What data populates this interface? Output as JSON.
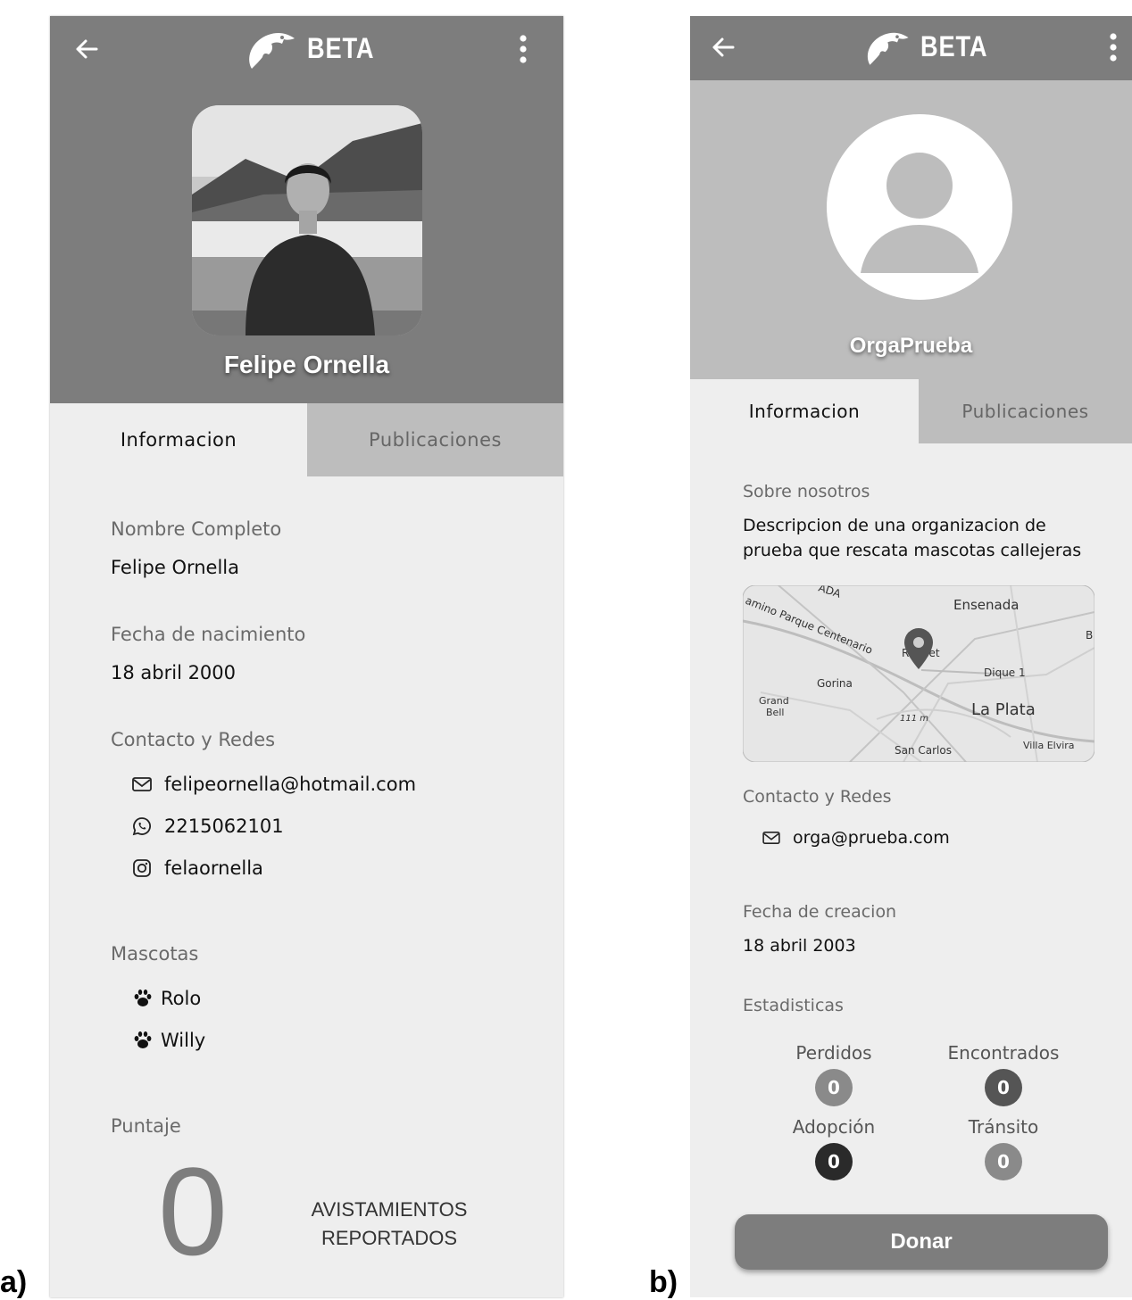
{
  "panel_labels": {
    "a": "a)",
    "b": "b)"
  },
  "app": {
    "logo_text": "BETA"
  },
  "screen_a": {
    "profile_name": "Felipe Ornella",
    "tabs": [
      {
        "label": "Informacion",
        "active": true
      },
      {
        "label": "Publicaciones",
        "active": false
      }
    ],
    "full_name": {
      "label": "Nombre Completo",
      "value": "Felipe Ornella"
    },
    "birth_date": {
      "label": "Fecha de nacimiento",
      "value": "18 abril 2000"
    },
    "contact": {
      "label": "Contacto y Redes",
      "items": [
        {
          "icon": "mail-icon",
          "value": "felipeornella@hotmail.com"
        },
        {
          "icon": "whatsapp-icon",
          "value": "2215062101"
        },
        {
          "icon": "instagram-icon",
          "value": "felaornella"
        }
      ]
    },
    "pets": {
      "label": "Mascotas",
      "items": [
        {
          "icon": "paw-icon",
          "name": "Rolo"
        },
        {
          "icon": "paw-icon",
          "name": "Willy"
        }
      ]
    },
    "score": {
      "label": "Puntaje",
      "value": "0",
      "caption_line1": "AVISTAMIENTOS",
      "caption_line2": "REPORTADOS"
    }
  },
  "screen_b": {
    "profile_name": "OrgaPrueba",
    "tabs": [
      {
        "label": "Informacion",
        "active": true
      },
      {
        "label": "Publicaciones",
        "active": false
      }
    ],
    "about": {
      "label": "Sobre nosotros",
      "line1": "Descripcion de una organizacion de",
      "line2": "prueba que rescata mascotas callejeras"
    },
    "map": {
      "labels": {
        "ensenada": "Ensenada",
        "la_plata": "La Plata",
        "gorina": "Gorina",
        "grand_bell_1": "Grand",
        "grand_bell_2": "Bell",
        "dique": "Dique 1",
        "san_carlos": "San Carlos",
        "villa_elvira": "Villa Elvira",
        "camino": "amino Parque Centenario",
        "ada": "ADA",
        "ruelet": "R  uelet",
        "dist": "111 m",
        "b": "B"
      }
    },
    "contact": {
      "label": "Contacto y Redes",
      "items": [
        {
          "icon": "mail-icon",
          "value": "orga@prueba.com"
        }
      ]
    },
    "creation_date": {
      "label": "Fecha de creacion",
      "value": "18 abril 2003"
    },
    "stats": {
      "label": "Estadisticas",
      "items": [
        {
          "label": "Perdidos",
          "value": "0",
          "color": "#8a8a8a"
        },
        {
          "label": "Encontrados",
          "value": "0",
          "color": "#555555"
        },
        {
          "label": "Adopción",
          "value": "0",
          "color": "#2a2a2a"
        },
        {
          "label": "Tránsito",
          "value": "0",
          "color": "#8a8a8a"
        }
      ]
    },
    "donate_label": "Donar"
  }
}
